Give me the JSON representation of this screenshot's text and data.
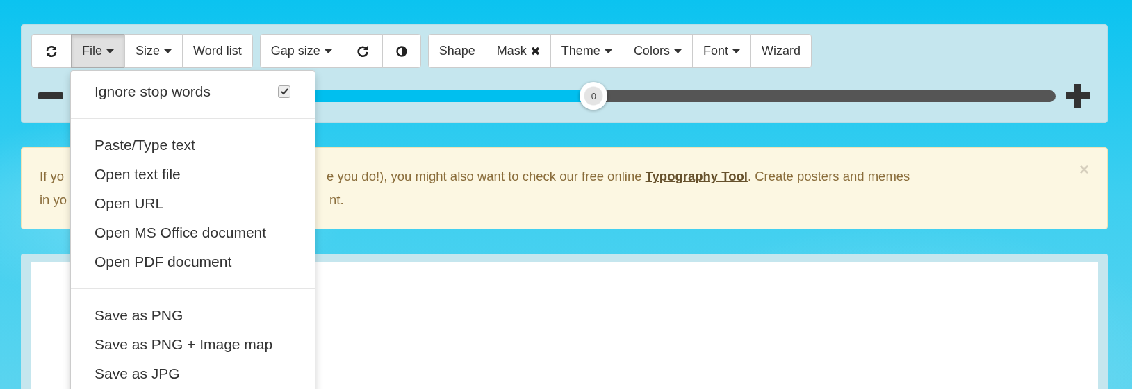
{
  "toolbar": {
    "groups": [
      [
        {
          "kind": "refresh",
          "active": false
        },
        {
          "kind": "menu",
          "label": "File",
          "active": true
        },
        {
          "kind": "menu",
          "label": "Size",
          "active": false
        },
        {
          "kind": "text",
          "label": "Word list",
          "active": false
        }
      ],
      [
        {
          "kind": "menu",
          "label": "Gap size",
          "active": false
        },
        {
          "kind": "rotate",
          "active": false
        },
        {
          "kind": "contrast",
          "active": false
        }
      ],
      [
        {
          "kind": "text",
          "label": "Shape",
          "active": false
        },
        {
          "kind": "remove",
          "label": "Mask",
          "active": false
        },
        {
          "kind": "menu",
          "label": "Theme",
          "active": false
        },
        {
          "kind": "menu",
          "label": "Colors",
          "active": false
        },
        {
          "kind": "menu",
          "label": "Font",
          "active": false
        },
        {
          "kind": "text",
          "label": "Wizard",
          "active": false
        }
      ]
    ],
    "slider": {
      "level": 0.53,
      "value": "0"
    }
  },
  "alert": {
    "lines": [
      {
        "left": "If yo",
        "right": "e you do!), you might also want to check our free online **Typography Tool**. Create posters and memes"
      },
      {
        "left": "in yo",
        "right": "nt."
      }
    ],
    "close": "×"
  },
  "file_menu": {
    "sections": [
      [
        {
          "kind": "check",
          "label": "Ignore stop words",
          "checked": true
        }
      ],
      [
        {
          "kind": "item",
          "label": "Paste/Type text"
        },
        {
          "kind": "item",
          "label": "Open text file"
        },
        {
          "kind": "item",
          "label": "Open URL"
        },
        {
          "kind": "item",
          "label": "Open MS Office document"
        },
        {
          "kind": "item",
          "label": "Open PDF document"
        }
      ],
      [
        {
          "kind": "item",
          "label": "Save as PNG"
        },
        {
          "kind": "item",
          "label": "Save as PNG + Image map"
        },
        {
          "kind": "item",
          "label": "Save as JPG"
        }
      ]
    ]
  }
}
